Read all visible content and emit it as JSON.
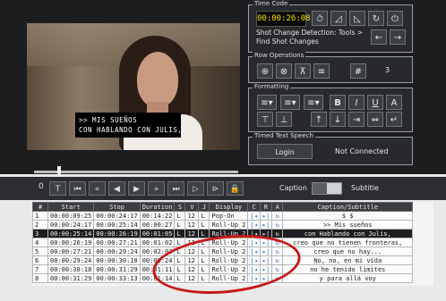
{
  "time_code": {
    "panel_title": "Time Code",
    "value": "00:00:26:08",
    "shot_change_text": "Shot Change Detection: Tools >",
    "find_shot_text": "Find Shot Changes",
    "buttons": [
      "timer-icon",
      "mark-in-icon",
      "mark-out-icon",
      "sync-icon",
      "power-icon"
    ]
  },
  "row_operations": {
    "panel_title": "Row Operations",
    "count": "3"
  },
  "formatting": {
    "panel_title": "Formatting"
  },
  "timed_text_speech": {
    "panel_title": "Timed Text Speech",
    "login_label": "Login",
    "status": "Not Connected"
  },
  "video": {
    "subtitle_lines": [
      ">> MIS SUEÑOS",
      "CON HABLANDO CON JULIS,"
    ]
  },
  "transport": {
    "number": "0",
    "caption_label": "Caption",
    "subtitle_label": "Subtitle"
  },
  "table": {
    "headers": [
      "#",
      "Start",
      "Stop",
      "Duration",
      "S",
      "V",
      "J",
      "Display",
      "C",
      "R",
      "A",
      "Caption/Subtitle"
    ],
    "rows": [
      [
        "1",
        "00:00:09:25",
        "00:00:24:17",
        "00:14:22",
        "L",
        "12",
        "L",
        "Pop-On",
        "",
        "",
        "",
        "$ $"
      ],
      [
        "2",
        "00:00:24:17",
        "00:00:25:14",
        "00:00:27",
        "L",
        "12",
        "L",
        "Roll-Up 2",
        "",
        "",
        "",
        ">> Mis sueños"
      ],
      [
        "3",
        "00:00:25:14",
        "00:00:26:19",
        "00:01:05",
        "L",
        "12",
        "L",
        "Roll-Up 2",
        "",
        "",
        "",
        "con Hablando con Julis,"
      ],
      [
        "4",
        "00:00:26:19",
        "00:00:27:21",
        "00:01:02",
        "L",
        "12",
        "L",
        "Roll-Up 2",
        "",
        "",
        "",
        "creo que no tienen fronteras,"
      ],
      [
        "5",
        "00:00:27:21",
        "00:00:29:24",
        "00:02:03",
        "L",
        "12",
        "L",
        "Roll-Up 2",
        "",
        "",
        "",
        "creo que no hay..."
      ],
      [
        "6",
        "00:00:29:24",
        "00:00:30:18",
        "00:00:24",
        "L",
        "12",
        "L",
        "Roll-Up 2",
        "",
        "",
        "",
        "No, no, en mi vida"
      ],
      [
        "7",
        "00:00:30:18",
        "00:00:31:29",
        "00:01:11",
        "L",
        "12",
        "L",
        "Roll-Up 2",
        "",
        "",
        "",
        "no he tenido límites"
      ],
      [
        "8",
        "00:00:31:29",
        "00:00:33:13",
        "00:01:14",
        "L",
        "12",
        "L",
        "Roll-Up 2",
        "",
        "",
        "",
        "y para allá voy"
      ]
    ],
    "selected_row": 3
  }
}
